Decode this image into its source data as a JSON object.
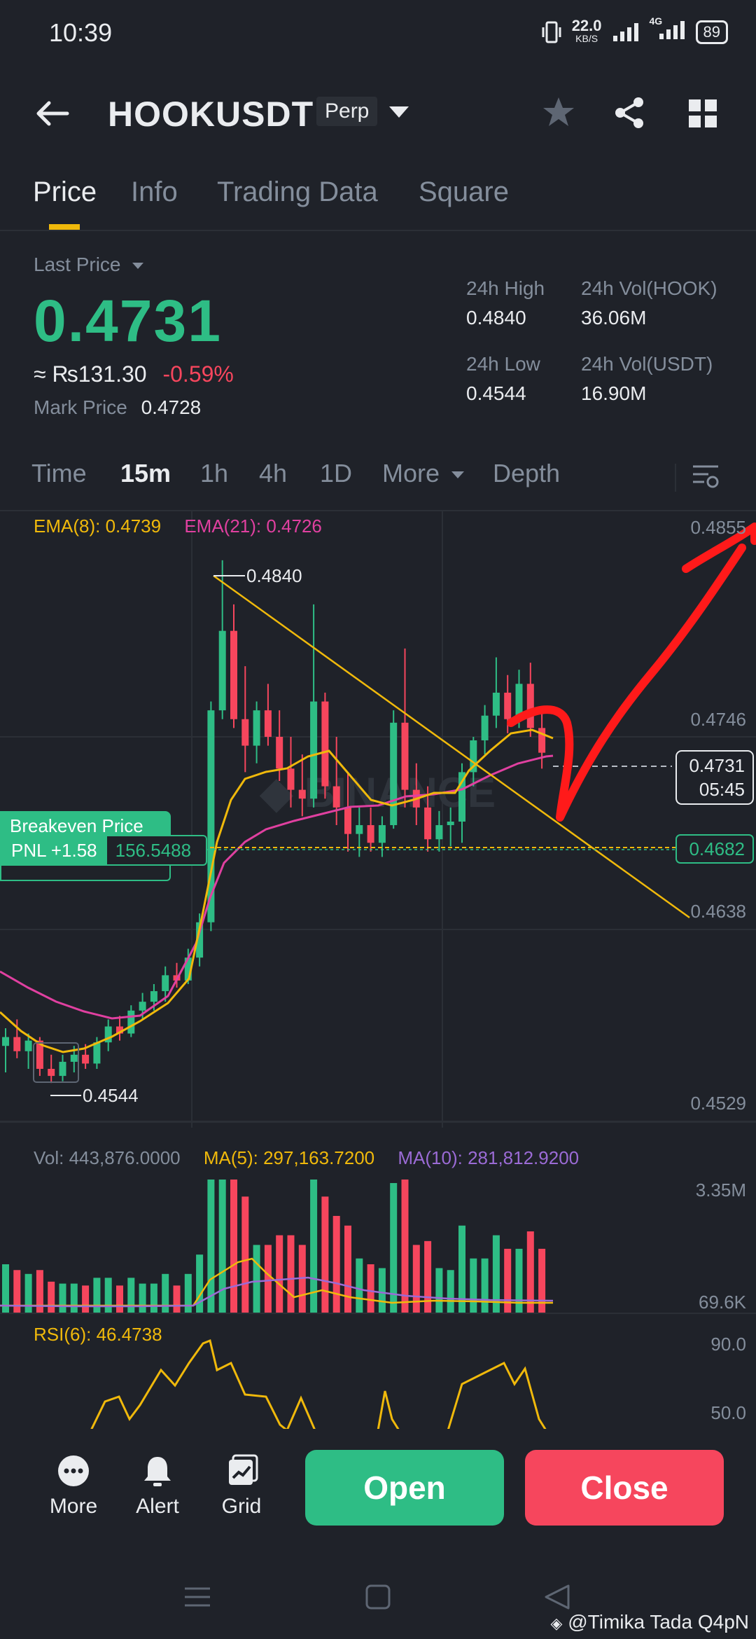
{
  "status": {
    "time": "10:39",
    "net_speed": "22.0",
    "net_unit": "KB/S",
    "net_type": "4G",
    "battery": "89"
  },
  "header": {
    "symbol": "HOOKUSDT",
    "badge": "Perp"
  },
  "tabs": [
    {
      "label": "Price"
    },
    {
      "label": "Info"
    },
    {
      "label": "Trading Data"
    },
    {
      "label": "Square"
    }
  ],
  "ticker": {
    "last_price_label": "Last Price",
    "last_price": "0.4731",
    "inr": "≈ ₨131.30",
    "change": "-0.59%",
    "mark_label": "Mark Price",
    "mark_value": "0.4728",
    "high_label": "24h High",
    "high": "0.4840",
    "vol_hook_label": "24h Vol(HOOK)",
    "vol_hook": "36.06M",
    "low_label": "24h Low",
    "low": "0.4544",
    "vol_usdt_label": "24h Vol(USDT)",
    "vol_usdt": "16.90M"
  },
  "timeframes": [
    {
      "label": "Time"
    },
    {
      "label": "15m"
    },
    {
      "label": "1h"
    },
    {
      "label": "4h"
    },
    {
      "label": "1D"
    },
    {
      "label": "More"
    },
    {
      "label": "Depth"
    }
  ],
  "chart": {
    "ema8": "EMA(8): 0.4739",
    "ema21": "EMA(21): 0.4726",
    "y_labels": [
      "0.4855",
      "0.4746",
      "0.4638",
      "0.4529"
    ],
    "high_marker": "0.4840",
    "low_marker": "0.4544",
    "current_price": "0.4731",
    "countdown": "05:45",
    "position_price": "0.4682",
    "breakeven_label": "Breakeven Price",
    "pnl_label": "PNL +1.58",
    "pnl_value": "156.5488",
    "vol_label": "Vol: 443,876.0000",
    "ma5": "MA(5): 297,163.7200",
    "ma10": "MA(10): 281,812.9200",
    "vol_max": "3.35M",
    "vol_min": "69.6K",
    "rsi_label": "RSI(6): 46.4738",
    "rsi_90": "90.0",
    "rsi_50": "50.0",
    "colors": {
      "up": "#2ebd85",
      "down": "#f6465d",
      "ema8": "#f0b90b",
      "ema21": "#e040a0",
      "ma10": "#9b6bd6"
    }
  },
  "chart_data": {
    "type": "candlestick",
    "ylim": [
      0.4529,
      0.4855
    ],
    "candles": [
      [
        0.4565,
        0.4575,
        0.455,
        0.457
      ],
      [
        0.457,
        0.458,
        0.4558,
        0.4562
      ],
      [
        0.4562,
        0.4572,
        0.4552,
        0.4568
      ],
      [
        0.4568,
        0.457,
        0.4548,
        0.4552
      ],
      [
        0.4552,
        0.456,
        0.4544,
        0.4548
      ],
      [
        0.4548,
        0.456,
        0.4545,
        0.4556
      ],
      [
        0.4556,
        0.4565,
        0.455,
        0.456
      ],
      [
        0.456,
        0.4566,
        0.4552,
        0.4555
      ],
      [
        0.4555,
        0.457,
        0.4552,
        0.4567
      ],
      [
        0.4567,
        0.458,
        0.4562,
        0.4576
      ],
      [
        0.4576,
        0.4582,
        0.4568,
        0.4572
      ],
      [
        0.4572,
        0.4588,
        0.457,
        0.4585
      ],
      [
        0.4585,
        0.4595,
        0.458,
        0.459
      ],
      [
        0.459,
        0.46,
        0.4585,
        0.4596
      ],
      [
        0.4596,
        0.461,
        0.459,
        0.4605
      ],
      [
        0.4605,
        0.4612,
        0.4598,
        0.4602
      ],
      [
        0.4602,
        0.462,
        0.46,
        0.4615
      ],
      [
        0.4615,
        0.464,
        0.461,
        0.4635
      ],
      [
        0.4635,
        0.476,
        0.463,
        0.4755
      ],
      [
        0.4755,
        0.484,
        0.475,
        0.48
      ],
      [
        0.48,
        0.4815,
        0.4745,
        0.475
      ],
      [
        0.475,
        0.478,
        0.472,
        0.4735
      ],
      [
        0.4735,
        0.476,
        0.4725,
        0.4755
      ],
      [
        0.4755,
        0.477,
        0.4735,
        0.474
      ],
      [
        0.474,
        0.4755,
        0.4715,
        0.4722
      ],
      [
        0.4722,
        0.474,
        0.47,
        0.471
      ],
      [
        0.471,
        0.473,
        0.4695,
        0.4705
      ],
      [
        0.4705,
        0.4815,
        0.47,
        0.476
      ],
      [
        0.476,
        0.4765,
        0.4705,
        0.4712
      ],
      [
        0.4712,
        0.474,
        0.469,
        0.47
      ],
      [
        0.47,
        0.472,
        0.4675,
        0.4685
      ],
      [
        0.4685,
        0.47,
        0.4672,
        0.469
      ],
      [
        0.469,
        0.47,
        0.4675,
        0.468
      ],
      [
        0.468,
        0.4695,
        0.4672,
        0.469
      ],
      [
        0.469,
        0.4755,
        0.4688,
        0.4748
      ],
      [
        0.4748,
        0.479,
        0.47,
        0.471
      ],
      [
        0.471,
        0.4725,
        0.469,
        0.47
      ],
      [
        0.47,
        0.4712,
        0.4675,
        0.4682
      ],
      [
        0.4682,
        0.4698,
        0.4675,
        0.469
      ],
      [
        0.469,
        0.47,
        0.4678,
        0.4692
      ],
      [
        0.4692,
        0.4725,
        0.468,
        0.472
      ],
      [
        0.472,
        0.474,
        0.4712,
        0.4738
      ],
      [
        0.4738,
        0.4758,
        0.473,
        0.4752
      ],
      [
        0.4752,
        0.4785,
        0.4745,
        0.4765
      ],
      [
        0.4765,
        0.4775,
        0.4742,
        0.475
      ],
      [
        0.475,
        0.4778,
        0.4745,
        0.477
      ],
      [
        0.477,
        0.4782,
        0.474,
        0.4745
      ],
      [
        0.4745,
        0.4755,
        0.4722,
        0.4731
      ]
    ]
  },
  "bottom_nav": [
    {
      "label": "More"
    },
    {
      "label": "Alert"
    },
    {
      "label": "Grid"
    }
  ],
  "actions": {
    "open": "Open",
    "close": "Close"
  },
  "watermark": "@Timika Tada Q4pN"
}
